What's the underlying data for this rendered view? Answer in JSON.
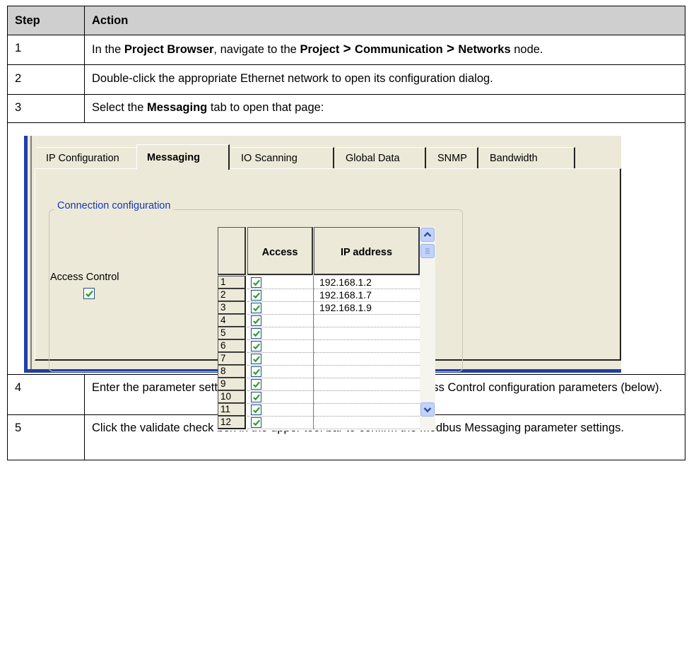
{
  "table": {
    "headers": {
      "step": "Step",
      "action": "Action"
    },
    "rows": [
      {
        "step": "1",
        "parts": [
          "In the ",
          "Project Browser",
          ", navigate to the ",
          "Project",
          " > ",
          "Communication",
          " > ",
          "Networks",
          " node."
        ]
      },
      {
        "step": "2",
        "text": "Double-click the appropriate Ethernet network to open its configuration dialog."
      },
      {
        "step": "3",
        "parts": [
          "Select the ",
          "Messaging",
          " tab to open that page:"
        ]
      },
      {
        "step": "4",
        "text": "Enter the parameter settings for Access Control. Refer to the Access Control configuration parameters (below)."
      },
      {
        "step": "5",
        "text": "Click the validate check box in the upper tool bar to confirm the Modbus Messaging parameter settings."
      }
    ]
  },
  "dialog": {
    "tabs": [
      "IP Configuration",
      "Messaging",
      "IO Scanning",
      "Global Data",
      "SNMP",
      "Bandwidth"
    ],
    "active_tab": "Messaging",
    "group_title": "Connection configuration",
    "access_control_label": "Access Control",
    "access_control_checked": true,
    "grid": {
      "headers": {
        "access": "Access",
        "ip": "IP address"
      },
      "rows": [
        {
          "num": "1",
          "checked": true,
          "ip": "192.168.1.2"
        },
        {
          "num": "2",
          "checked": true,
          "ip": "192.168.1.7"
        },
        {
          "num": "3",
          "checked": true,
          "ip": "192.168.1.9"
        },
        {
          "num": "4",
          "checked": true,
          "ip": ""
        },
        {
          "num": "5",
          "checked": true,
          "ip": ""
        },
        {
          "num": "6",
          "checked": true,
          "ip": ""
        },
        {
          "num": "7",
          "checked": true,
          "ip": ""
        },
        {
          "num": "8",
          "checked": true,
          "ip": ""
        },
        {
          "num": "9",
          "checked": true,
          "ip": ""
        },
        {
          "num": "10",
          "checked": true,
          "ip": ""
        },
        {
          "num": "11",
          "checked": true,
          "ip": ""
        },
        {
          "num": "12",
          "checked": true,
          "ip": ""
        }
      ]
    },
    "colors": {
      "tab_bg": "#ece9d8",
      "frame_blue": "#1f3fa8",
      "group_title": "#1538b5",
      "check": "#2a9d2a"
    }
  }
}
